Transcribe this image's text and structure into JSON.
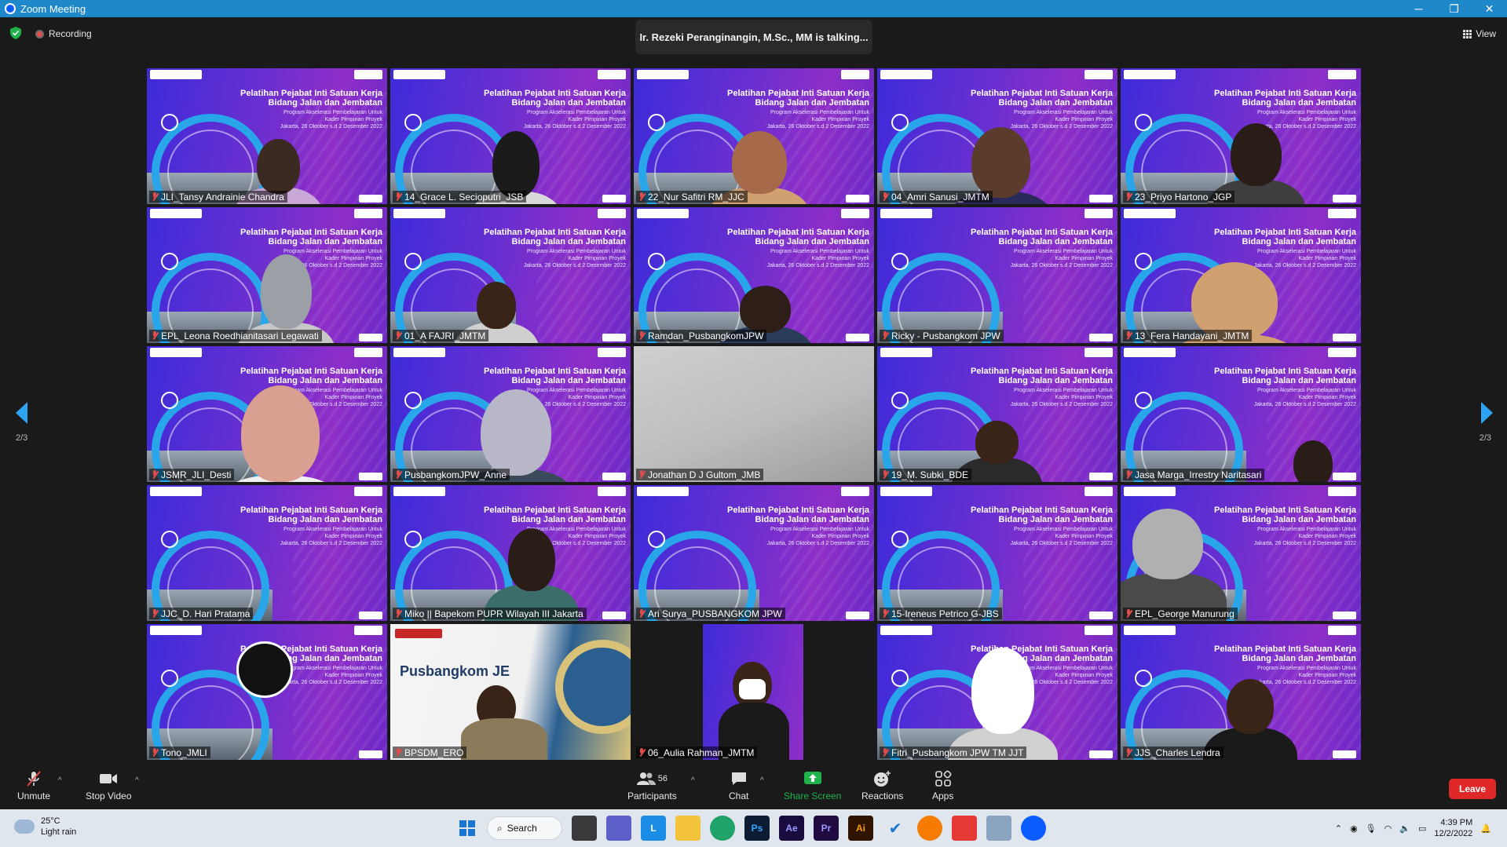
{
  "window": {
    "title": "Zoom Meeting",
    "minimize": "─",
    "maximize": "❐",
    "close": "✕"
  },
  "header": {
    "recording_label": "Recording",
    "talking": "Ir. Rezeki Peranginangin, M.Sc., MM is talking...",
    "view_label": "View"
  },
  "banner": {
    "title_line1": "Pelatihan Pejabat Inti Satuan Kerja",
    "title_line2": "Bidang Jalan dan Jembatan",
    "sub_line1": "Program Akselerasi Pembelajaran Untuk",
    "sub_line2": "Kader Pimpinan Proyek",
    "sub_line3": "Jakarta, 26 Oktober s.d 2 Desember 2022"
  },
  "participants": [
    {
      "name": "JLI_Tansy Andrainie Chandra"
    },
    {
      "name": "14_Grace L. Secioputri_JSB"
    },
    {
      "name": "22_Nur Safitri RM_JJC"
    },
    {
      "name": "04_Amri Sanusi_JMTM"
    },
    {
      "name": "23_Priyo Hartono_JGP"
    },
    {
      "name": "EPL_Leona Roedhianitasari Legawati"
    },
    {
      "name": "01_A FAJRI_JMTM"
    },
    {
      "name": "Ramdan_PusbangkomJPW"
    },
    {
      "name": "Ricky - Pusbangkom JPW"
    },
    {
      "name": "13_Fera Handayani_JMTM"
    },
    {
      "name": "JSMR_JLI_Desti"
    },
    {
      "name": "PusbangkomJPW_Anne"
    },
    {
      "name": "Jonathan D J Gultom_JMB"
    },
    {
      "name": "19_M. Subki_BDE"
    },
    {
      "name": "Jasa Marga_Irrestry Naritasari"
    },
    {
      "name": "JJC_D. Hari Pratama"
    },
    {
      "name": "Miko || Bapekom PUPR Wilayah III Jakarta"
    },
    {
      "name": "Ari Surya_PUSBANGKOM JPW"
    },
    {
      "name": "15-Ireneus Petrico G-JBS"
    },
    {
      "name": "EPL_George Manurung"
    },
    {
      "name": "Tono_JMLI"
    },
    {
      "name": "BPSDM_ERO"
    },
    {
      "name": "06_Aulia Rahman_JMTM"
    },
    {
      "name": "Fitri_Pusbangkom JPW TM JJT"
    },
    {
      "name": "JJS_Charles Lendra"
    }
  ],
  "bpsdm_tile": {
    "headline": "Pusbangkom JE"
  },
  "pager": {
    "left": "2/3",
    "right": "2/3"
  },
  "toolbar": {
    "unmute": "Unmute",
    "stop_video": "Stop Video",
    "participants": "Participants",
    "participant_count": "56",
    "chat": "Chat",
    "share_screen": "Share Screen",
    "reactions": "Reactions",
    "apps": "Apps",
    "leave": "Leave",
    "caret": "^"
  },
  "taskbar": {
    "temperature": "25°C",
    "weather": "Light rain",
    "search": "Search",
    "time": "4:39 PM",
    "date": "12/2/2022",
    "apps": [
      "Ps",
      "Ae",
      "Pr",
      "Ai"
    ]
  },
  "colors": {
    "accent": "#2ea3f2",
    "leave": "#e02828",
    "share_screen": "#1fb14a",
    "muted": "#e34a4a"
  }
}
